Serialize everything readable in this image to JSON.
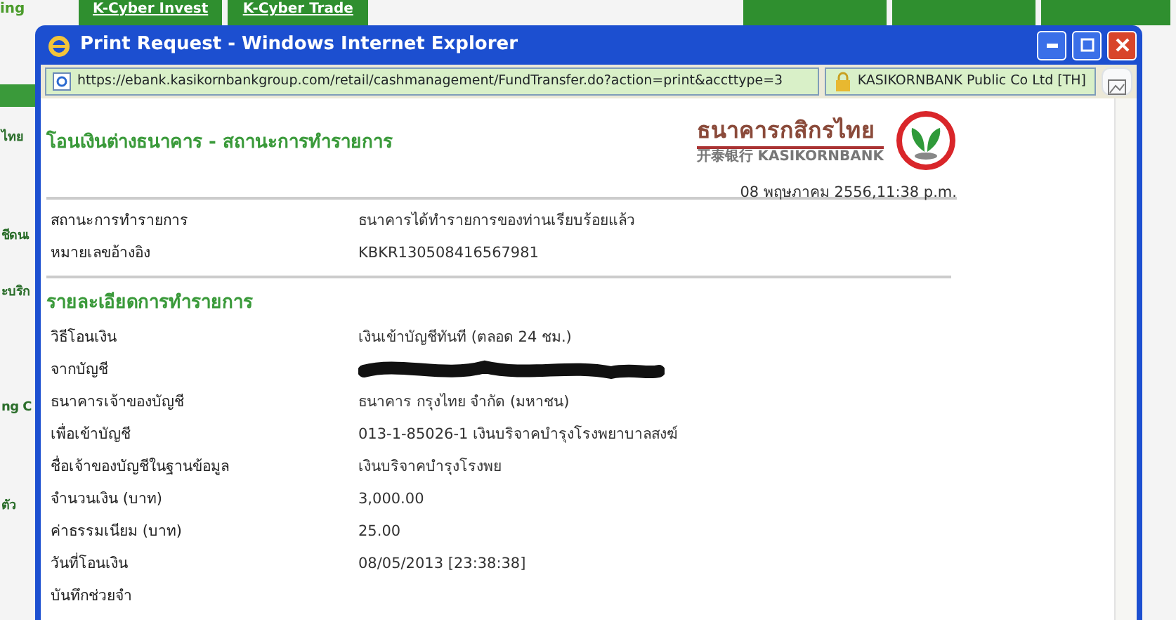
{
  "background_page": {
    "top_left_text": "ing",
    "top_tabs": [
      {
        "label": "K-Cyber Invest"
      },
      {
        "label": "K-Cyber Trade"
      }
    ],
    "sidebar_fragments": [
      "ไทย",
      "ชีดนเ",
      "ะบริก",
      "ng C",
      "ตัว"
    ]
  },
  "window": {
    "title": "Print Request - Windows Internet Explorer",
    "url": "https://ebank.kasikornbankgroup.com/retail/cashmanagement/FundTransfer.do?action=print&accttype=3",
    "security_label": "KASIKORNBANK Public Co Ltd [TH]"
  },
  "page": {
    "heading": "โอนเงินต่างธนาคาร - สถานะการทำรายการ",
    "logo": {
      "thai_name": "ธนาคารกสิกรไทย",
      "english_name": "开泰银行 KASIKORNBANK"
    },
    "date": "08 พฤษภาคม 2556,11:38 p.m.",
    "status_rows": [
      {
        "label": "สถานะการทำรายการ",
        "value": "ธนาคารได้ทำรายการของท่านเรียบร้อยแล้ว",
        "kind": "text"
      },
      {
        "label": "หมายเลขอ้างอิง",
        "value": "KBKR130508416567981",
        "kind": "text"
      }
    ],
    "details_heading": "รายละเอียดการทำรายการ",
    "detail_rows": [
      {
        "label": "วิธีโอนเงิน",
        "value": "เงินเข้าบัญชีทันที (ตลอด 24 ชม.)",
        "kind": "text"
      },
      {
        "label": "จากบัญชี",
        "kind": "redacted"
      },
      {
        "label": "ธนาคารเจ้าของบัญชี",
        "value": "ธนาคาร กรุงไทย จำกัด (มหาชน)",
        "kind": "text"
      },
      {
        "label": "เพื่อเข้าบัญชี",
        "value": "013-1-85026-1 เงินบริจาคบำรุงโรงพยาบาลสงฆ์",
        "kind": "text"
      },
      {
        "label": "ชื่อเจ้าของบัญชีในฐานข้อมูล",
        "value": "เงินบริจาคบำรุงโรงพย",
        "kind": "text"
      },
      {
        "label": "จำนวนเงิน (บาท)",
        "value": "3,000.00",
        "kind": "text"
      },
      {
        "label": "ค่าธรรมเนียม (บาท)",
        "value": "25.00",
        "kind": "text"
      },
      {
        "label": "วันที่โอนเงิน",
        "value": "08/05/2013 [23:38:38]",
        "kind": "text"
      },
      {
        "label": "บันทึกช่วยจำ",
        "kind": "empty"
      }
    ]
  }
}
